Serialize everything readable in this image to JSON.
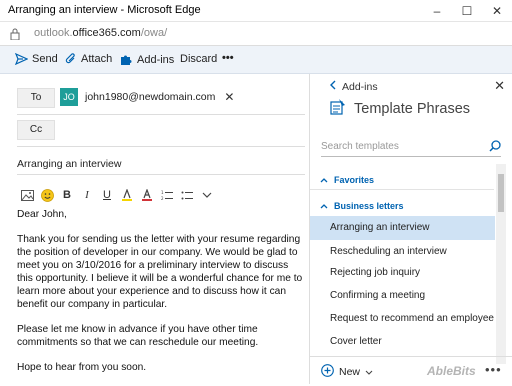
{
  "window": {
    "title": "Arranging an interview - Microsoft Edge",
    "minimize": "–",
    "maximize": "☐",
    "close": "✕"
  },
  "address": {
    "host": "outlook.",
    "domain": "office365.com",
    "path": "/owa/"
  },
  "toolbar": {
    "send": "Send",
    "attach": "Attach",
    "addins": "Add-ins",
    "discard": "Discard",
    "more": "•••"
  },
  "compose": {
    "to_label": "To",
    "cc_label": "Cc",
    "recipient": {
      "initials": "JO",
      "email": "john1980@newdomain.com",
      "remove": "✕"
    },
    "subject": "Arranging an interview",
    "body": [
      "Dear John,",
      "Thank you for sending us the letter with your resume regarding the position of developer in our company. We would be glad to meet you on 3/10/2016 for a preliminary interview to discuss this opportunity. I believe it will be a wonderful chance for me to learn more about your experience and to discuss how it can benefit our company in particular.",
      "Please let me know in advance if you have other time commitments so that we can reschedule our meeting.",
      "Hope to hear from you soon."
    ]
  },
  "pane": {
    "back_label": "Add-ins",
    "close": "✕",
    "title": "Template Phrases",
    "search_placeholder": "Search templates",
    "favorites": "Favorites",
    "business": "Business letters",
    "templates": [
      "Arranging an interview",
      "Rescheduling an interview",
      "Rejecting job inquiry",
      "Confirming a meeting",
      "Request to recommend an employee",
      "Cover letter"
    ],
    "selected_index": 0,
    "new_label": "New",
    "logo": "AbleBits",
    "more": "•••"
  },
  "colors": {
    "accent": "#0063b1",
    "avatar": "#1e9e99",
    "selected": "#cfe2f4",
    "toolbar_bg": "#eef3f9"
  }
}
